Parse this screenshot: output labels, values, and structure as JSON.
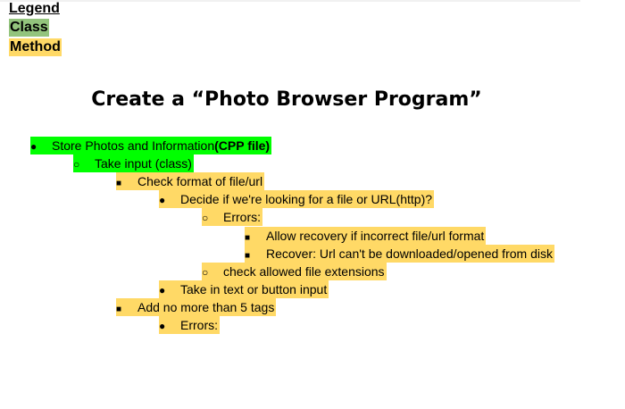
{
  "legend": {
    "title": "Legend",
    "class_label": "Class",
    "method_label": "Method"
  },
  "title": "Create a “Photo Browser Program”",
  "colors": {
    "class": "#00ff00",
    "class_legend": "#93c47d",
    "method": "#ffd966"
  },
  "outline": [
    {
      "bullet": "●",
      "text": "Store Photos and Information",
      "bold_suffix": "(CPP file)",
      "highlight": "class"
    },
    {
      "bullet": "○",
      "text": "Take input (class)",
      "highlight": "class"
    },
    {
      "bullet": "■",
      "text": "Check format of file/url",
      "highlight": "method"
    },
    {
      "bullet": "●",
      "text": "Decide if we're looking for a file or URL(http)?",
      "highlight": "method"
    },
    {
      "bullet": "○",
      "text": "Errors:",
      "highlight": "method"
    },
    {
      "bullet": "■",
      "text": "Allow recovery if incorrect file/url format",
      "highlight": "method"
    },
    {
      "bullet": "■",
      "text": "Recover: Url can't be downloaded/opened from disk",
      "highlight": "method"
    },
    {
      "bullet": "○",
      "text": "check allowed file extensions",
      "highlight": "method"
    },
    {
      "bullet": "●",
      "text": "Take in text or button input",
      "highlight": "method"
    },
    {
      "bullet": "■",
      "text": "Add no more than 5 tags",
      "highlight": "method"
    },
    {
      "bullet": "●",
      "text": "Errors:",
      "highlight": "method"
    }
  ]
}
